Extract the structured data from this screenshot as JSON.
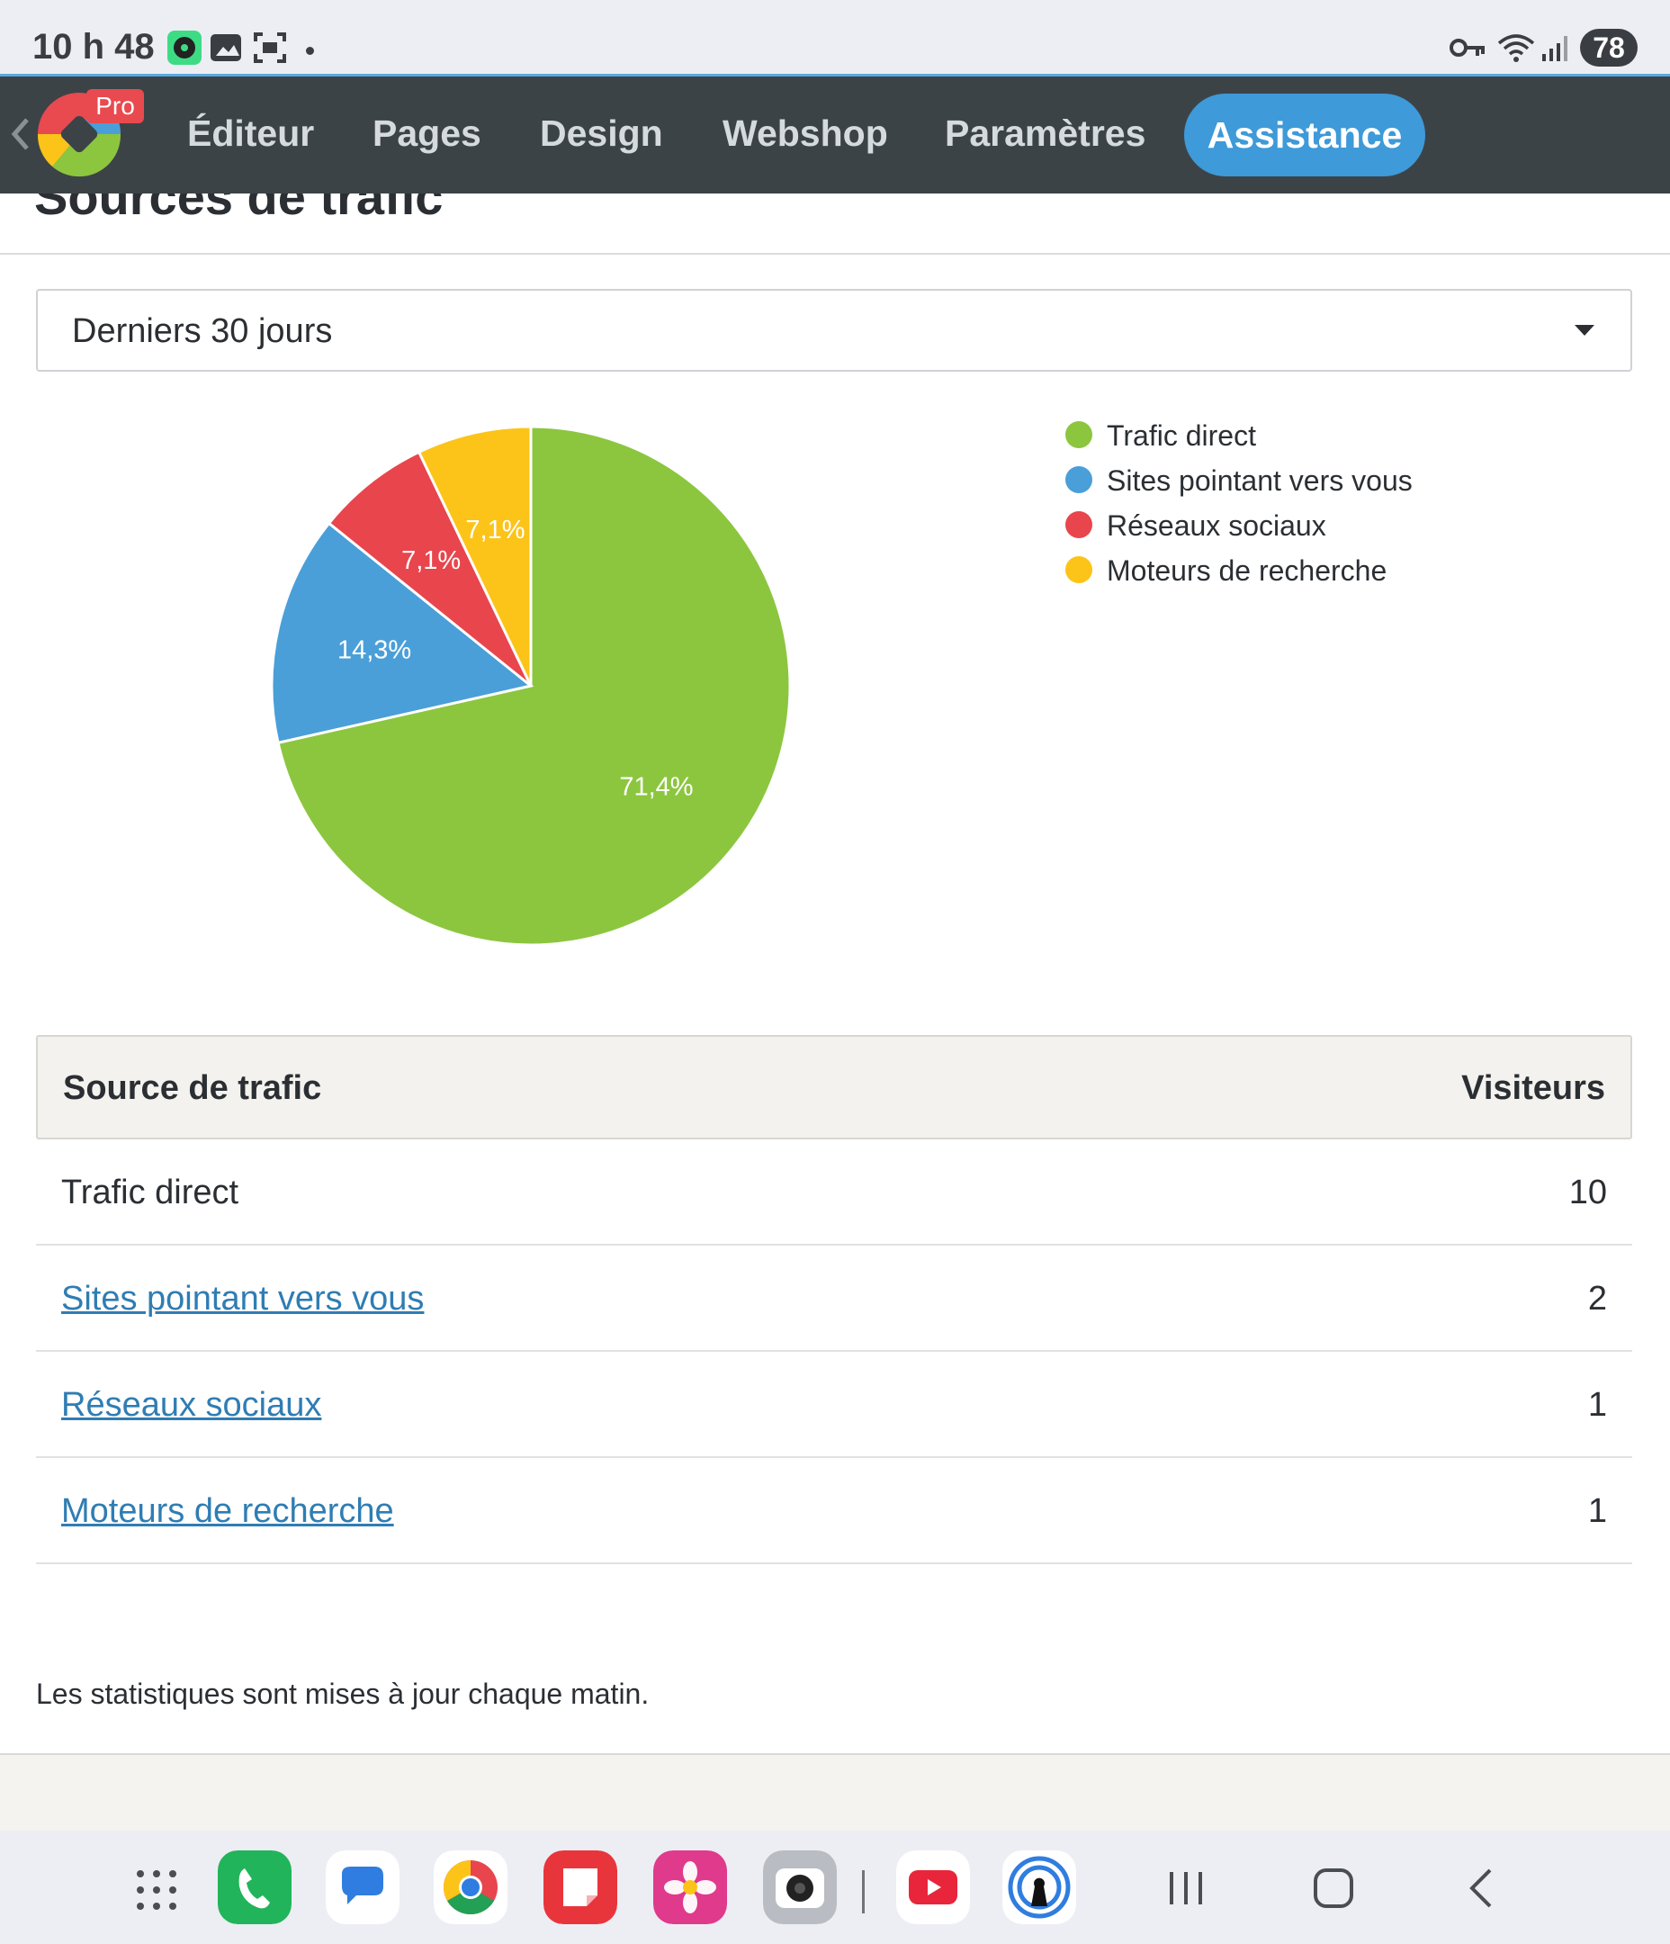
{
  "status_bar": {
    "time": "10 h 48",
    "battery": "78"
  },
  "nav": {
    "items": [
      "Éditeur",
      "Pages",
      "Design",
      "Webshop",
      "Paramètres"
    ],
    "active": "Assistance",
    "badge": "Pro"
  },
  "page": {
    "title": "Sources de trafic",
    "period_select": {
      "value": "Derniers 30 jours"
    },
    "footnote": "Les statistiques sont mises à jour chaque matin."
  },
  "chart_data": {
    "type": "pie",
    "series": [
      {
        "name": "Trafic direct",
        "value": 71.4,
        "label": "71,4%",
        "color": "#8cc63f"
      },
      {
        "name": "Sites pointant vers vous",
        "value": 14.3,
        "label": "14,3%",
        "color": "#4a9fd8"
      },
      {
        "name": "Réseaux sociaux",
        "value": 7.1,
        "label": "7,1%",
        "color": "#e8454d"
      },
      {
        "name": "Moteurs de recherche",
        "value": 7.1,
        "label": "7,1%",
        "color": "#fcc419"
      }
    ],
    "legend": "top-right"
  },
  "table": {
    "headers": {
      "source": "Source de trafic",
      "visitors": "Visiteurs"
    },
    "rows": [
      {
        "source": "Trafic direct",
        "visitors": "10",
        "link": false
      },
      {
        "source": "Sites pointant vers vous",
        "visitors": "2",
        "link": true
      },
      {
        "source": "Réseaux sociaux",
        "visitors": "1",
        "link": true
      },
      {
        "source": "Moteurs de recherche",
        "visitors": "1",
        "link": true
      }
    ]
  },
  "dock": {
    "apps": [
      "apps-grid-icon",
      "phone-icon",
      "messages-icon",
      "chrome-icon",
      "notes-icon",
      "gallery-icon",
      "camera-icon",
      "youtube-icon",
      "vpn-icon"
    ],
    "nav_buttons": [
      "recent-apps-icon",
      "home-icon",
      "back-icon"
    ]
  }
}
